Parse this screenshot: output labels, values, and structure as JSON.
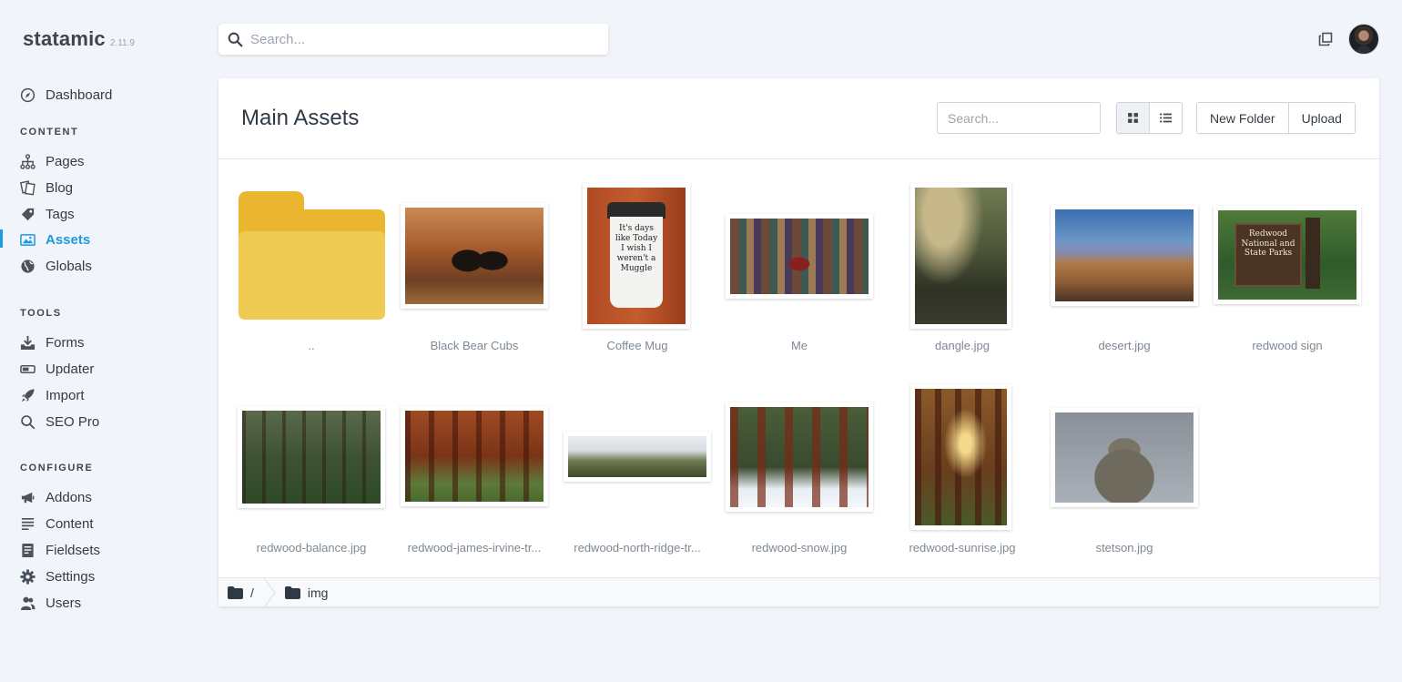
{
  "brand": {
    "name": "statamic",
    "version": "2.11.9"
  },
  "header": {
    "search_placeholder": "Search..."
  },
  "sidebar": {
    "dashboard": "Dashboard",
    "sections": [
      {
        "heading": "CONTENT",
        "items": [
          "Pages",
          "Blog",
          "Tags",
          "Assets",
          "Globals"
        ]
      },
      {
        "heading": "TOOLS",
        "items": [
          "Forms",
          "Updater",
          "Import",
          "SEO Pro"
        ]
      },
      {
        "heading": "CONFIGURE",
        "items": [
          "Addons",
          "Content",
          "Fieldsets",
          "Settings",
          "Users"
        ]
      }
    ],
    "active_item": "Assets"
  },
  "main": {
    "title": "Main Assets",
    "search_placeholder": "Search...",
    "buttons": {
      "new_folder": "New Folder",
      "upload": "Upload"
    },
    "assets": [
      {
        "label": ".."
      },
      {
        "label": "Black Bear Cubs"
      },
      {
        "label": "Coffee Mug"
      },
      {
        "label": "Me"
      },
      {
        "label": "dangle.jpg"
      },
      {
        "label": "desert.jpg"
      },
      {
        "label": "redwood sign",
        "sign_text": "Redwood National and State Parks"
      },
      {
        "label": "redwood-balance.jpg"
      },
      {
        "label": "redwood-james-irvine-tr..."
      },
      {
        "label": "redwood-north-ridge-tr..."
      },
      {
        "label": "redwood-snow.jpg"
      },
      {
        "label": "redwood-sunrise.jpg"
      },
      {
        "label": "stetson.jpg"
      }
    ],
    "mug_text": "It's days like Today I wish I weren't a Muggle",
    "breadcrumb": {
      "root": "/",
      "folder": "img"
    }
  },
  "colors": {
    "accent": "#1b9be0",
    "folder": "#f0cb53"
  }
}
